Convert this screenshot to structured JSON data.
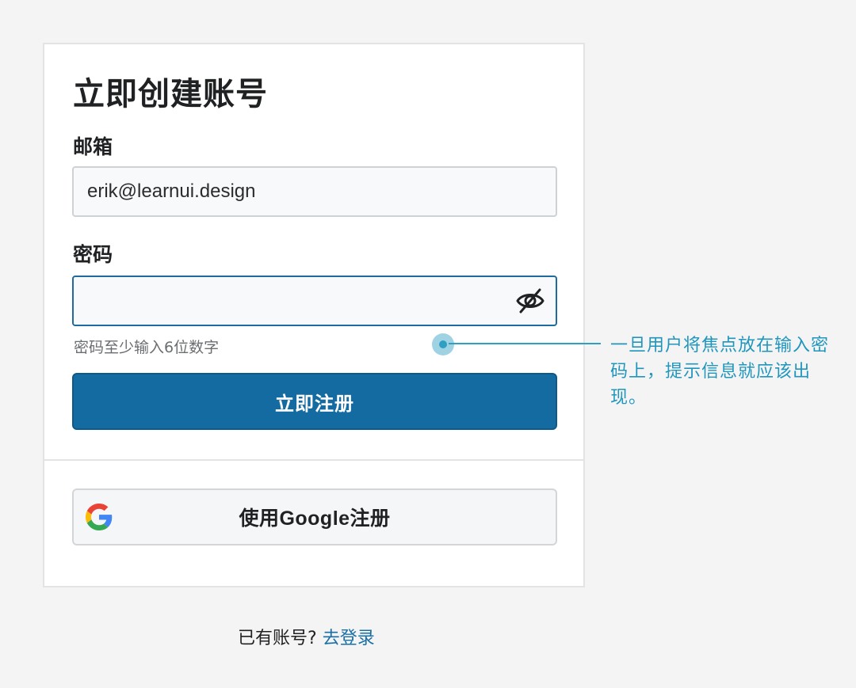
{
  "form": {
    "title": "立即创建账号",
    "email_label": "邮箱",
    "email_value": "erik@learnui.design",
    "password_label": "密码",
    "password_value": "",
    "password_toggle_icon": "eye-off-icon",
    "password_hint": "密码至少输入6位数字",
    "submit_label": "立即注册",
    "google_label": "使用Google注册",
    "google_icon": "google-logo-icon"
  },
  "footer": {
    "prompt": "已有账号?",
    "login_link": "去登录"
  },
  "annotation": {
    "text": "一旦用户将焦点放在输入密码上，提示信息就应该出现。"
  },
  "colors": {
    "primary": "#136ba1",
    "focus_border": "#1e6c9f",
    "annotation": "#2196bd",
    "link": "#1a6fa5"
  }
}
